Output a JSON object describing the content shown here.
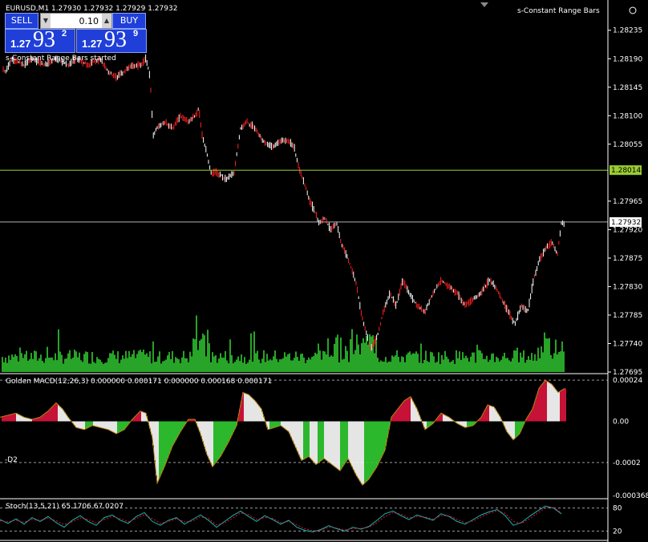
{
  "header": {
    "symbol_info": "EURUSD,M1  1.27930 1.27932 1.27929 1.27932",
    "indicator_name": "s-Constant Range Bars",
    "status_text": "s-Constant Range Bars started"
  },
  "trade_panel": {
    "sell_label": "SELL",
    "buy_label": "BUY",
    "lot_value": "0.10",
    "sell_price_prefix": "1.27",
    "sell_price_big": "93",
    "sell_price_sup": "2",
    "buy_price_prefix": "1.27",
    "buy_price_big": "93",
    "buy_price_sup": "9"
  },
  "colors": {
    "background": "#000000",
    "bull_candle": "#ffffff",
    "bear_candle": "#ff2020",
    "volume": "#32cd32",
    "hline_green": "#9acd32",
    "hline_grey": "#b0b0b0",
    "macd_up": "#dc143c",
    "macd_down": "#32cd32",
    "macd_weak": "#ffffff",
    "stoch_main": "#20b2aa",
    "stoch_signal": "#dc143c"
  },
  "chart_data": [
    {
      "type": "line",
      "panel": "price",
      "symbol": "EURUSD",
      "timeframe": "M1",
      "ylim": [
        1.27695,
        1.2826
      ],
      "yticks": [
        "1.28235",
        "1.28190",
        "1.28145",
        "1.28100",
        "1.28055",
        "1.27965",
        "1.27920",
        "1.27875",
        "1.27830",
        "1.27785",
        "1.27740",
        "1.27695"
      ],
      "hline_green": "1.28014",
      "current_price": "1.27932",
      "price_path": [
        [
          0,
          1.2818
        ],
        [
          7,
          1.2817
        ],
        [
          15,
          1.2819
        ],
        [
          30,
          1.2818
        ],
        [
          40,
          1.2819
        ],
        [
          55,
          1.2818
        ],
        [
          70,
          1.2819
        ],
        [
          85,
          1.2818
        ],
        [
          95,
          1.2819
        ],
        [
          110,
          1.2818
        ],
        [
          125,
          1.2819
        ],
        [
          135,
          1.2817
        ],
        [
          145,
          1.2816
        ],
        [
          155,
          1.2817
        ],
        [
          165,
          1.2818
        ],
        [
          175,
          1.2818
        ],
        [
          182,
          1.2819
        ],
        [
          186,
          1.2817
        ],
        [
          188,
          1.2814
        ],
        [
          191,
          1.2807
        ],
        [
          196,
          1.2808
        ],
        [
          205,
          1.2809
        ],
        [
          215,
          1.2808
        ],
        [
          225,
          1.281
        ],
        [
          235,
          1.2809
        ],
        [
          243,
          1.281
        ],
        [
          248,
          1.2811
        ],
        [
          252,
          1.2807
        ],
        [
          258,
          1.2804
        ],
        [
          263,
          1.2801
        ],
        [
          270,
          1.2801
        ],
        [
          282,
          1.28
        ],
        [
          292,
          1.2801
        ],
        [
          300,
          1.2808
        ],
        [
          308,
          1.2809
        ],
        [
          318,
          1.2808
        ],
        [
          328,
          1.2806
        ],
        [
          340,
          1.2805
        ],
        [
          350,
          1.2806
        ],
        [
          360,
          1.2806
        ],
        [
          367,
          1.2805
        ],
        [
          372,
          1.2802
        ],
        [
          378,
          1.28
        ],
        [
          385,
          1.2797
        ],
        [
          392,
          1.2795
        ],
        [
          398,
          1.2793
        ],
        [
          405,
          1.2794
        ],
        [
          412,
          1.2792
        ],
        [
          420,
          1.2793
        ],
        [
          425,
          1.279
        ],
        [
          432,
          1.2788
        ],
        [
          438,
          1.2786
        ],
        [
          445,
          1.2783
        ],
        [
          450,
          1.2779
        ],
        [
          456,
          1.2776
        ],
        [
          462,
          1.2773
        ],
        [
          470,
          1.2775
        ],
        [
          478,
          1.2779
        ],
        [
          486,
          1.2782
        ],
        [
          494,
          1.278
        ],
        [
          502,
          1.2784
        ],
        [
          510,
          1.2782
        ],
        [
          520,
          1.278
        ],
        [
          530,
          1.2779
        ],
        [
          540,
          1.2782
        ],
        [
          550,
          1.2784
        ],
        [
          560,
          1.2783
        ],
        [
          570,
          1.2782
        ],
        [
          580,
          1.278
        ],
        [
          590,
          1.2781
        ],
        [
          600,
          1.2782
        ],
        [
          610,
          1.2784
        ],
        [
          618,
          1.2783
        ],
        [
          626,
          1.2781
        ],
        [
          634,
          1.2779
        ],
        [
          642,
          1.2777
        ],
        [
          650,
          1.278
        ],
        [
          658,
          1.2779
        ],
        [
          665,
          1.2784
        ],
        [
          672,
          1.2787
        ],
        [
          680,
          1.2789
        ],
        [
          688,
          1.279
        ],
        [
          695,
          1.2788
        ],
        [
          700,
          1.2793
        ]
      ]
    },
    {
      "type": "bar",
      "panel": "macd",
      "title": "Golden MACD(12,26,3) 0.000000 0.000171 0.000000 0.000168 0.000171",
      "ylim": [
        -0.000368,
        0.000224
      ],
      "yticks": [
        "0.00024",
        "0.00",
        "-0.0002",
        "-0.000368"
      ],
      "levels": {
        "upper": "0.0002",
        "d2": "-0.0002",
        "d2_label": "-D2"
      },
      "path": [
        [
          0,
          2e-05
        ],
        [
          10,
          3e-05
        ],
        [
          20,
          4e-05
        ],
        [
          30,
          2e-05
        ],
        [
          40,
          1e-05
        ],
        [
          50,
          2e-05
        ],
        [
          60,
          5e-05
        ],
        [
          70,
          9e-05
        ],
        [
          78,
          6e-05
        ],
        [
          85,
          2e-05
        ],
        [
          95,
          -3e-05
        ],
        [
          105,
          -4e-05
        ],
        [
          115,
          -2e-05
        ],
        [
          125,
          -3e-05
        ],
        [
          135,
          -4e-05
        ],
        [
          145,
          -6e-05
        ],
        [
          155,
          -4e-05
        ],
        [
          165,
          1e-05
        ],
        [
          175,
          5e-05
        ],
        [
          182,
          4e-05
        ],
        [
          190,
          -8e-05
        ],
        [
          196,
          -0.0003
        ],
        [
          205,
          -0.00022
        ],
        [
          215,
          -0.00012
        ],
        [
          225,
          -5e-05
        ],
        [
          235,
          1e-05
        ],
        [
          243,
          1e-05
        ],
        [
          250,
          -6e-05
        ],
        [
          258,
          -0.00016
        ],
        [
          265,
          -0.00022
        ],
        [
          275,
          -0.00017
        ],
        [
          285,
          -0.0001
        ],
        [
          295,
          -2e-05
        ],
        [
          303,
          0.00014
        ],
        [
          310,
          0.00013
        ],
        [
          318,
          0.0001
        ],
        [
          326,
          6e-05
        ],
        [
          334,
          -4e-05
        ],
        [
          342,
          -3e-05
        ],
        [
          350,
          -2e-05
        ],
        [
          360,
          -5e-05
        ],
        [
          368,
          -0.00012
        ],
        [
          376,
          -0.00019
        ],
        [
          385,
          -0.00017
        ],
        [
          394,
          -0.00021
        ],
        [
          404,
          -0.00018
        ],
        [
          414,
          -0.00021
        ],
        [
          424,
          -0.00024
        ],
        [
          434,
          -0.00018
        ],
        [
          444,
          -0.00026
        ],
        [
          452,
          -0.00031
        ],
        [
          460,
          -0.00028
        ],
        [
          470,
          -0.00022
        ],
        [
          480,
          -0.00014
        ],
        [
          488,
          2e-05
        ],
        [
          496,
          6e-05
        ],
        [
          504,
          0.0001
        ],
        [
          512,
          0.00012
        ],
        [
          520,
          6e-05
        ],
        [
          530,
          -4e-05
        ],
        [
          540,
          -1e-05
        ],
        [
          550,
          4e-05
        ],
        [
          560,
          2e-05
        ],
        [
          570,
          -1e-05
        ],
        [
          580,
          -3e-05
        ],
        [
          590,
          -2e-05
        ],
        [
          600,
          2e-05
        ],
        [
          608,
          8e-05
        ],
        [
          616,
          7e-05
        ],
        [
          624,
          2e-05
        ],
        [
          632,
          -5e-05
        ],
        [
          640,
          -9e-05
        ],
        [
          648,
          -6e-05
        ],
        [
          656,
          1e-05
        ],
        [
          664,
          6e-05
        ],
        [
          672,
          0.00016
        ],
        [
          680,
          0.0002
        ],
        [
          688,
          0.00018
        ],
        [
          696,
          0.00014
        ],
        [
          704,
          0.00016
        ]
      ]
    },
    {
      "type": "line",
      "panel": "stochastic",
      "title": "Stoch(13,5,21) 65.1706 67.0207",
      "ylim": [
        0,
        100
      ],
      "levels": [
        "80",
        "20"
      ],
      "main": [
        [
          0,
          50
        ],
        [
          10,
          40
        ],
        [
          20,
          52
        ],
        [
          30,
          38
        ],
        [
          40,
          55
        ],
        [
          50,
          45
        ],
        [
          60,
          58
        ],
        [
          70,
          42
        ],
        [
          80,
          30
        ],
        [
          90,
          48
        ],
        [
          100,
          60
        ],
        [
          110,
          45
        ],
        [
          120,
          35
        ],
        [
          130,
          55
        ],
        [
          140,
          62
        ],
        [
          150,
          48
        ],
        [
          160,
          40
        ],
        [
          170,
          58
        ],
        [
          180,
          68
        ],
        [
          190,
          45
        ],
        [
          200,
          35
        ],
        [
          210,
          48
        ],
        [
          220,
          55
        ],
        [
          230,
          38
        ],
        [
          240,
          50
        ],
        [
          250,
          62
        ],
        [
          260,
          48
        ],
        [
          270,
          30
        ],
        [
          280,
          45
        ],
        [
          290,
          60
        ],
        [
          300,
          72
        ],
        [
          310,
          58
        ],
        [
          320,
          45
        ],
        [
          330,
          60
        ],
        [
          340,
          50
        ],
        [
          350,
          38
        ],
        [
          360,
          48
        ],
        [
          370,
          30
        ],
        [
          380,
          22
        ],
        [
          390,
          18
        ],
        [
          400,
          24
        ],
        [
          410,
          34
        ],
        [
          420,
          26
        ],
        [
          430,
          20
        ],
        [
          440,
          30
        ],
        [
          450,
          25
        ],
        [
          460,
          32
        ],
        [
          470,
          48
        ],
        [
          480,
          65
        ],
        [
          490,
          72
        ],
        [
          500,
          60
        ],
        [
          510,
          50
        ],
        [
          520,
          62
        ],
        [
          530,
          55
        ],
        [
          540,
          48
        ],
        [
          550,
          65
        ],
        [
          560,
          58
        ],
        [
          570,
          45
        ],
        [
          580,
          38
        ],
        [
          590,
          50
        ],
        [
          600,
          62
        ],
        [
          610,
          70
        ],
        [
          620,
          76
        ],
        [
          630,
          60
        ],
        [
          640,
          35
        ],
        [
          650,
          42
        ],
        [
          660,
          58
        ],
        [
          670,
          72
        ],
        [
          680,
          85
        ],
        [
          690,
          80
        ],
        [
          700,
          65
        ]
      ],
      "signal": [
        [
          0,
          47
        ],
        [
          10,
          44
        ],
        [
          20,
          48
        ],
        [
          30,
          43
        ],
        [
          40,
          50
        ],
        [
          50,
          48
        ],
        [
          60,
          53
        ],
        [
          70,
          47
        ],
        [
          80,
          37
        ],
        [
          90,
          44
        ],
        [
          100,
          54
        ],
        [
          110,
          50
        ],
        [
          120,
          41
        ],
        [
          130,
          50
        ],
        [
          140,
          58
        ],
        [
          150,
          52
        ],
        [
          160,
          44
        ],
        [
          170,
          53
        ],
        [
          180,
          63
        ],
        [
          190,
          52
        ],
        [
          200,
          40
        ],
        [
          210,
          45
        ],
        [
          220,
          52
        ],
        [
          230,
          44
        ],
        [
          240,
          46
        ],
        [
          250,
          57
        ],
        [
          260,
          53
        ],
        [
          270,
          36
        ],
        [
          280,
          41
        ],
        [
          290,
          54
        ],
        [
          300,
          67
        ],
        [
          310,
          63
        ],
        [
          320,
          50
        ],
        [
          330,
          55
        ],
        [
          340,
          53
        ],
        [
          350,
          42
        ],
        [
          360,
          45
        ],
        [
          370,
          36
        ],
        [
          380,
          26
        ],
        [
          390,
          21
        ],
        [
          400,
          22
        ],
        [
          410,
          30
        ],
        [
          420,
          28
        ],
        [
          430,
          23
        ],
        [
          440,
          27
        ],
        [
          450,
          27
        ],
        [
          460,
          30
        ],
        [
          470,
          42
        ],
        [
          480,
          58
        ],
        [
          490,
          68
        ],
        [
          500,
          64
        ],
        [
          510,
          54
        ],
        [
          520,
          58
        ],
        [
          530,
          57
        ],
        [
          540,
          51
        ],
        [
          550,
          60
        ],
        [
          560,
          60
        ],
        [
          570,
          50
        ],
        [
          580,
          42
        ],
        [
          590,
          46
        ],
        [
          600,
          57
        ],
        [
          610,
          66
        ],
        [
          620,
          73
        ],
        [
          630,
          66
        ],
        [
          640,
          45
        ],
        [
          650,
          40
        ],
        [
          660,
          52
        ],
        [
          670,
          66
        ],
        [
          680,
          80
        ],
        [
          690,
          82
        ],
        [
          700,
          67
        ]
      ]
    }
  ]
}
